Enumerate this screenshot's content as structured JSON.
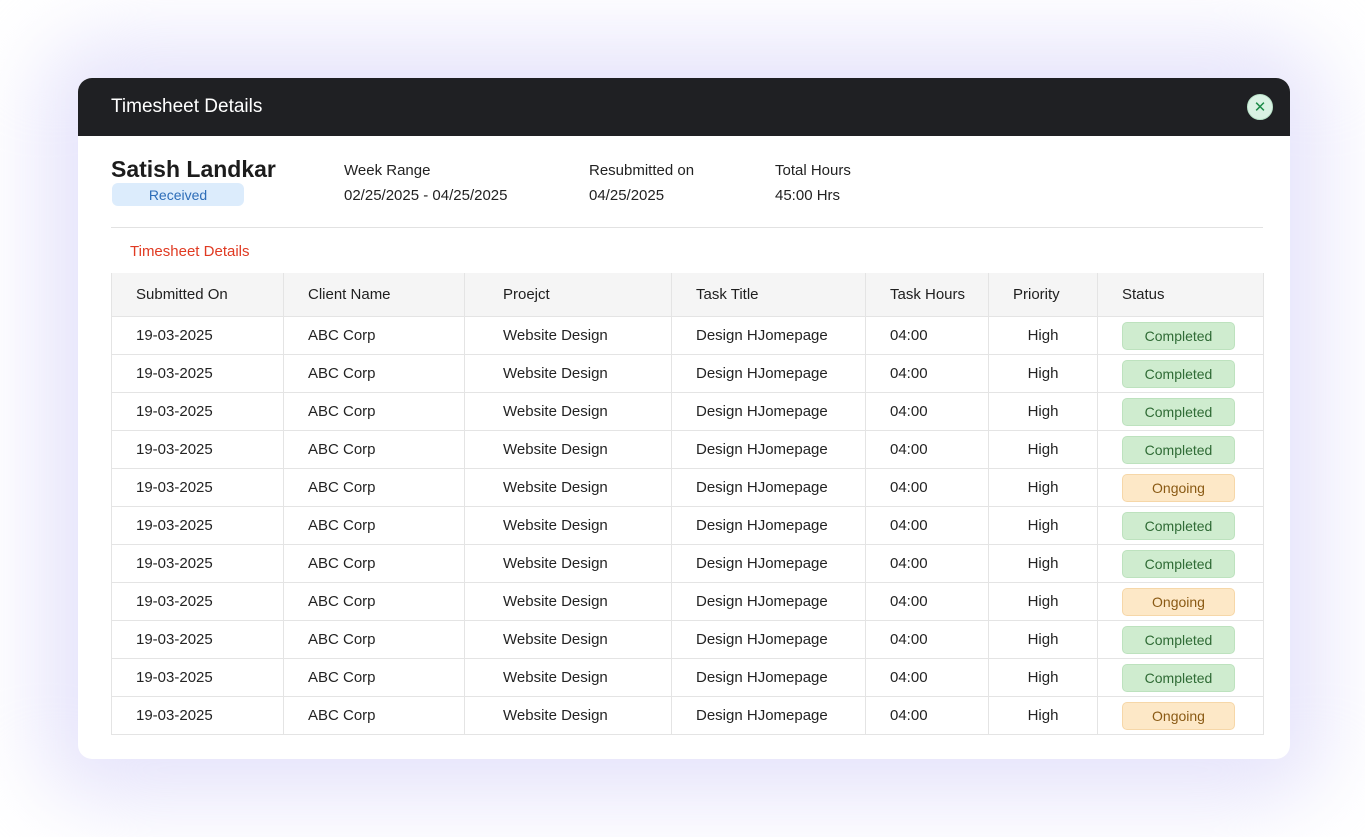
{
  "modal": {
    "title": "Timesheet Details",
    "close_icon": "close-icon"
  },
  "employee": {
    "name": "Satish Landkar",
    "status": "Received"
  },
  "meta": {
    "week_range_label": "Week Range",
    "week_range_value": "02/25/2025 - 04/25/2025",
    "resubmitted_label": "Resubmitted on",
    "resubmitted_value": "04/25/2025",
    "total_hours_label": "Total Hours",
    "total_hours_value": "45:00 Hrs"
  },
  "section_title": "Timesheet Details",
  "table": {
    "columns": [
      "Submitted On",
      "Client Name",
      "Proejct",
      "Task Title",
      "Task Hours",
      "Priority",
      "Status"
    ],
    "rows": [
      {
        "submitted_on": "19-03-2025",
        "client": "ABC Corp",
        "project": "Website Design",
        "task": "Design HJomepage",
        "hours": "04:00",
        "priority": "High",
        "status": "Completed"
      },
      {
        "submitted_on": "19-03-2025",
        "client": "ABC Corp",
        "project": "Website Design",
        "task": "Design HJomepage",
        "hours": "04:00",
        "priority": "High",
        "status": "Completed"
      },
      {
        "submitted_on": "19-03-2025",
        "client": "ABC Corp",
        "project": "Website Design",
        "task": "Design HJomepage",
        "hours": "04:00",
        "priority": "High",
        "status": "Completed"
      },
      {
        "submitted_on": "19-03-2025",
        "client": "ABC Corp",
        "project": "Website Design",
        "task": "Design HJomepage",
        "hours": "04:00",
        "priority": "High",
        "status": "Completed"
      },
      {
        "submitted_on": "19-03-2025",
        "client": "ABC Corp",
        "project": "Website Design",
        "task": "Design HJomepage",
        "hours": "04:00",
        "priority": "High",
        "status": "Ongoing"
      },
      {
        "submitted_on": "19-03-2025",
        "client": "ABC Corp",
        "project": "Website Design",
        "task": "Design HJomepage",
        "hours": "04:00",
        "priority": "High",
        "status": "Completed"
      },
      {
        "submitted_on": "19-03-2025",
        "client": "ABC Corp",
        "project": "Website Design",
        "task": "Design HJomepage",
        "hours": "04:00",
        "priority": "High",
        "status": "Completed"
      },
      {
        "submitted_on": "19-03-2025",
        "client": "ABC Corp",
        "project": "Website Design",
        "task": "Design HJomepage",
        "hours": "04:00",
        "priority": "High",
        "status": "Ongoing"
      },
      {
        "submitted_on": "19-03-2025",
        "client": "ABC Corp",
        "project": "Website Design",
        "task": "Design HJomepage",
        "hours": "04:00",
        "priority": "High",
        "status": "Completed"
      },
      {
        "submitted_on": "19-03-2025",
        "client": "ABC Corp",
        "project": "Website Design",
        "task": "Design HJomepage",
        "hours": "04:00",
        "priority": "High",
        "status": "Completed"
      },
      {
        "submitted_on": "19-03-2025",
        "client": "ABC Corp",
        "project": "Website Design",
        "task": "Design HJomepage",
        "hours": "04:00",
        "priority": "High",
        "status": "Ongoing"
      }
    ]
  },
  "colors": {
    "header_bg": "#1f2023",
    "accent_red": "#e03a22",
    "completed_bg": "#cfeccf",
    "ongoing_bg": "#fde8c7",
    "received_bg": "#dcecfc"
  }
}
